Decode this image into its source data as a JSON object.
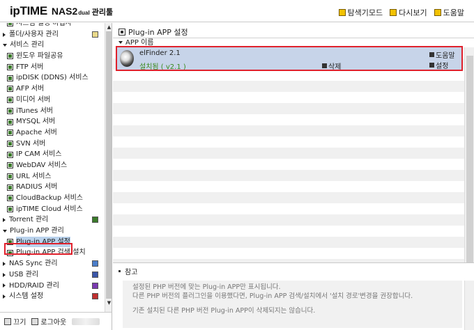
{
  "header": {
    "logo_brand": "ipTIME",
    "logo_model": "NAS2",
    "logo_edition": "dual",
    "logo_suffix": "관리툴",
    "links": [
      {
        "label": "탐색기모드",
        "icon": "explorer-icon"
      },
      {
        "label": "다시보기",
        "icon": "refresh-icon"
      },
      {
        "label": "도움말",
        "icon": "help-icon"
      }
    ]
  },
  "sidebar": {
    "items": [
      {
        "label": "시스템 설정 마법사",
        "type": "sub"
      },
      {
        "label": "폴더/사용자 관리",
        "type": "cat",
        "expanded": false
      },
      {
        "label": "서비스 관리",
        "type": "cat",
        "expanded": true
      },
      {
        "label": "윈도우 파일공유",
        "type": "sub"
      },
      {
        "label": "FTP 서버",
        "type": "sub"
      },
      {
        "label": "ipDISK (DDNS) 서비스",
        "type": "sub"
      },
      {
        "label": "AFP 서버",
        "type": "sub"
      },
      {
        "label": "미디어 서버",
        "type": "sub"
      },
      {
        "label": "iTunes 서버",
        "type": "sub"
      },
      {
        "label": "MYSQL 서버",
        "type": "sub"
      },
      {
        "label": "Apache 서버",
        "type": "sub"
      },
      {
        "label": "SVN 서버",
        "type": "sub"
      },
      {
        "label": "IP CAM 서비스",
        "type": "sub"
      },
      {
        "label": "WebDAV 서비스",
        "type": "sub"
      },
      {
        "label": "URL 서비스",
        "type": "sub"
      },
      {
        "label": "RADIUS 서버",
        "type": "sub"
      },
      {
        "label": "CloudBackup 서비스",
        "type": "sub"
      },
      {
        "label": "ipTIME Cloud 서비스",
        "type": "sub"
      },
      {
        "label": "Torrent 관리",
        "type": "cat",
        "expanded": false
      },
      {
        "label": "Plug-in APP 관리",
        "type": "cat",
        "expanded": true
      },
      {
        "label": "Plug-in APP 설정",
        "type": "sub",
        "selected": true
      },
      {
        "label": "Plug-in APP 검색/설치",
        "type": "sub"
      },
      {
        "label": "NAS Sync 관리",
        "type": "cat",
        "expanded": false
      },
      {
        "label": "USB 관리",
        "type": "cat",
        "expanded": false
      },
      {
        "label": "HDD/RAID 관리",
        "type": "cat",
        "expanded": false
      },
      {
        "label": "시스템 설정",
        "type": "cat",
        "expanded": false
      }
    ]
  },
  "footer": {
    "exit_label": "끄기",
    "logout_label": "로그아웃"
  },
  "main": {
    "title": "Plug-in APP 설정",
    "column_header": "APP 이름",
    "plugins": [
      {
        "name": "elFinder 2.1",
        "status": "설치됨 ( v2.1 )",
        "delete_label": "삭제",
        "help_label": "도움말",
        "settings_label": "설정"
      }
    ],
    "notes": {
      "title": "참고",
      "lines": [
        "설정된 PHP 버전에 맞는 Plug-in APP만 표시됩니다.",
        "다른 PHP 버전의 플러그인을 이용했다면, Plug-in APP 검색/설치에서 '설치 경로'변경을 권장합니다.",
        "기존 설치된 다른 PHP 버전 Plug-in APP이 삭제되지는 않습니다."
      ]
    }
  },
  "colors": {
    "selection_highlight": "#e0212c",
    "row_selected": "#c7d4e9",
    "status_green": "#3a8a1e"
  }
}
